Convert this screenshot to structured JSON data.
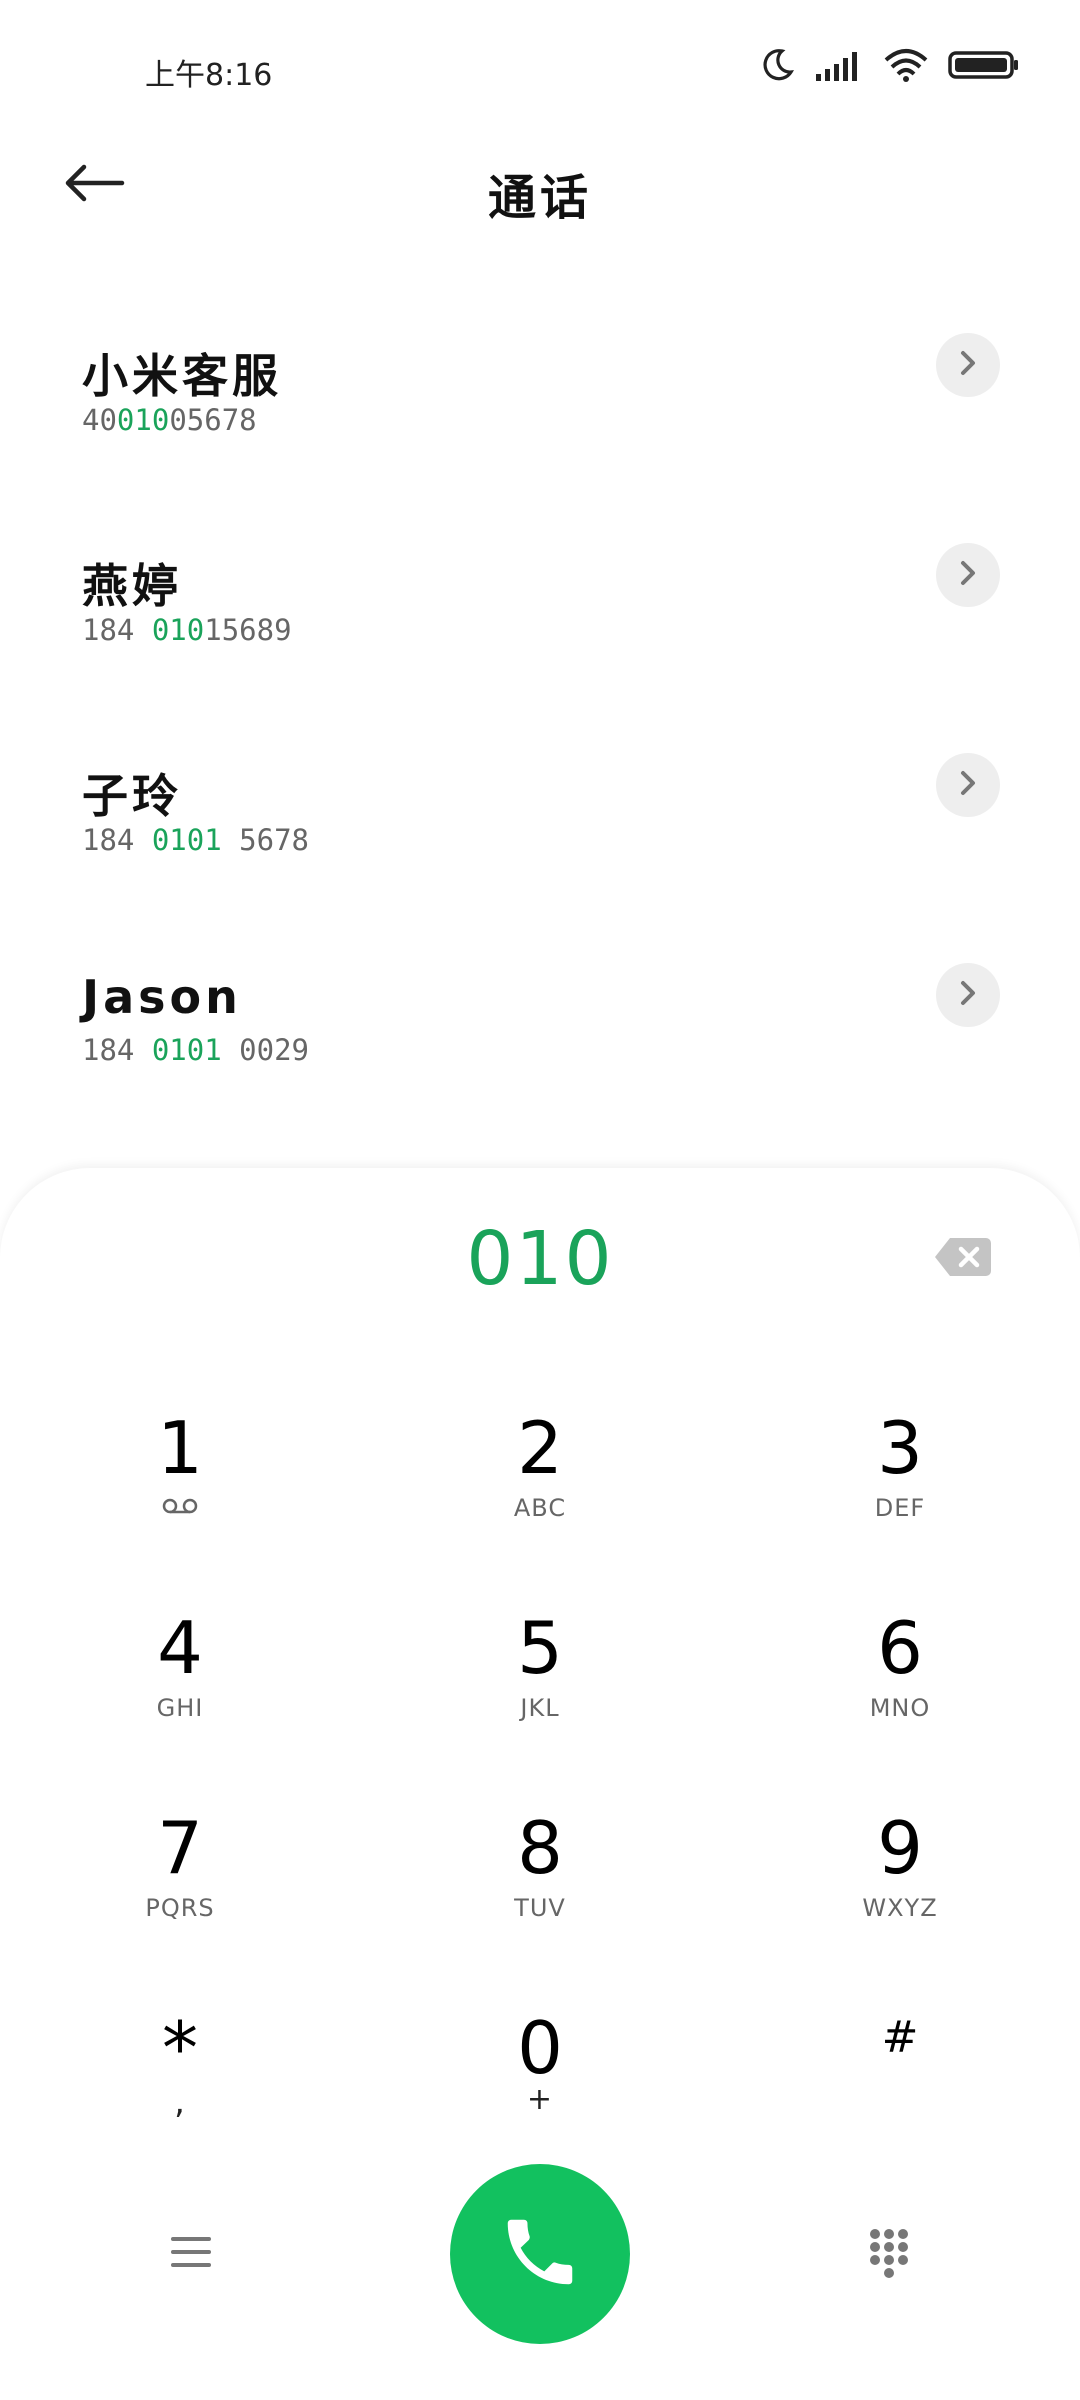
{
  "status_bar": {
    "time": "上午8:16"
  },
  "header": {
    "title": "通话"
  },
  "contacts": [
    {
      "name": "小米客服",
      "number_parts": [
        "40",
        "010",
        "05678"
      ]
    },
    {
      "name": "燕婷",
      "number_parts": [
        "184 ",
        "010",
        "15689"
      ]
    },
    {
      "name": "子玲",
      "number_parts": [
        "184 ",
        "0101",
        " 5678"
      ]
    },
    {
      "name": "Jason",
      "number_parts": [
        "184 ",
        "0101",
        " 0029"
      ]
    }
  ],
  "dialpad": {
    "input_value": "010",
    "keys": [
      {
        "digit": "1",
        "letters": "voicemail-icon"
      },
      {
        "digit": "2",
        "letters": "ABC"
      },
      {
        "digit": "3",
        "letters": "DEF"
      },
      {
        "digit": "4",
        "letters": "GHI"
      },
      {
        "digit": "5",
        "letters": "JKL"
      },
      {
        "digit": "6",
        "letters": "MNO"
      },
      {
        "digit": "7",
        "letters": "PQRS"
      },
      {
        "digit": "8",
        "letters": "TUV"
      },
      {
        "digit": "9",
        "letters": "WXYZ"
      },
      {
        "digit": "*",
        "letters": ","
      },
      {
        "digit": "0",
        "letters": "+"
      },
      {
        "digit": "#",
        "letters": ""
      }
    ]
  },
  "colors": {
    "accent": "#1aa35a",
    "call_button": "#12c15f"
  }
}
